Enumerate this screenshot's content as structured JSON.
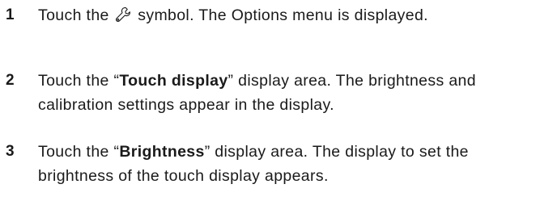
{
  "steps": [
    {
      "number": "1",
      "before": "Touch the ",
      "icon": "wrench-icon",
      "after": " symbol. The Options menu is displayed."
    },
    {
      "number": "2",
      "before": "Touch the “",
      "bold": "Touch display",
      "after": "” display area. The brightness and calibration settings appear in the display."
    },
    {
      "number": "3",
      "before": "Touch the “",
      "bold": "Brightness",
      "after": "” display area. The display to set the brightness of the touch display appears."
    }
  ]
}
